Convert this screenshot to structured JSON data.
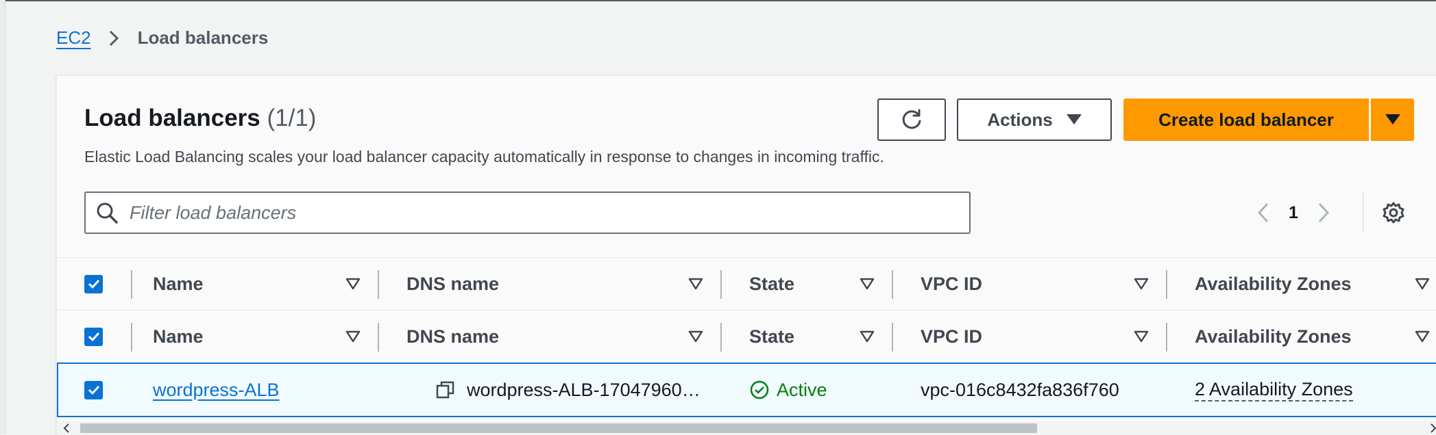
{
  "breadcrumb": {
    "parent": "EC2",
    "current": "Load balancers"
  },
  "panel": {
    "title": "Load balancers",
    "count": "(1/1)",
    "description": "Elastic Load Balancing scales your load balancer capacity automatically in response to changes in incoming traffic."
  },
  "toolbar": {
    "refresh_icon": "refresh-icon",
    "actions_label": "Actions",
    "create_label": "Create load balancer"
  },
  "filter": {
    "placeholder": "Filter load balancers",
    "value": ""
  },
  "pagination": {
    "current_page": "1"
  },
  "table": {
    "columns": [
      "Name",
      "DNS name",
      "State",
      "VPC ID",
      "Availability Zones"
    ],
    "header_rows": 2,
    "rows": [
      {
        "selected": true,
        "name": "wordpress-ALB",
        "dns_name": "wordpress-ALB-17047960…",
        "state": "Active",
        "vpc_id": "vpc-016c8432fa836f760",
        "availability_zones": "2 Availability Zones"
      }
    ]
  },
  "colors": {
    "primary_button": "#ff9900",
    "link": "#0972d3",
    "success": "#037f0c",
    "selected_row_bg": "#f1faff"
  }
}
